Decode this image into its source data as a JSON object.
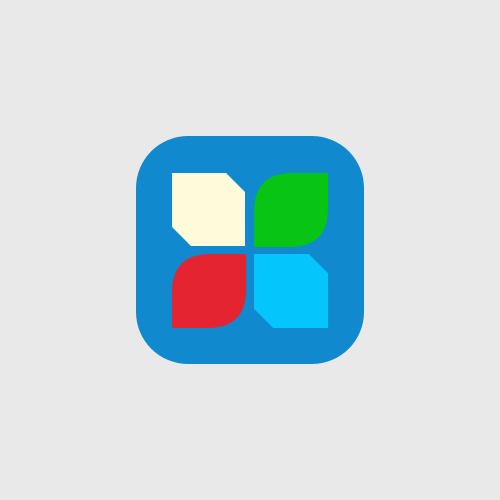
{
  "colors": {
    "background": "#E9E9E9",
    "icon_background": "#1089CF",
    "tile_cream": "#FFFBDA",
    "tile_green": "#08C415",
    "tile_red": "#E52431",
    "tile_cyan": "#05C5FD"
  },
  "icon": {
    "semantic_name": "four-leaf-tile-app-icon",
    "tiles": [
      {
        "name": "cream-tile",
        "shape": "square-with-clipped-corners"
      },
      {
        "name": "green-tile",
        "shape": "leaf"
      },
      {
        "name": "red-tile",
        "shape": "leaf"
      },
      {
        "name": "cyan-tile",
        "shape": "square-with-clipped-corners"
      }
    ]
  }
}
